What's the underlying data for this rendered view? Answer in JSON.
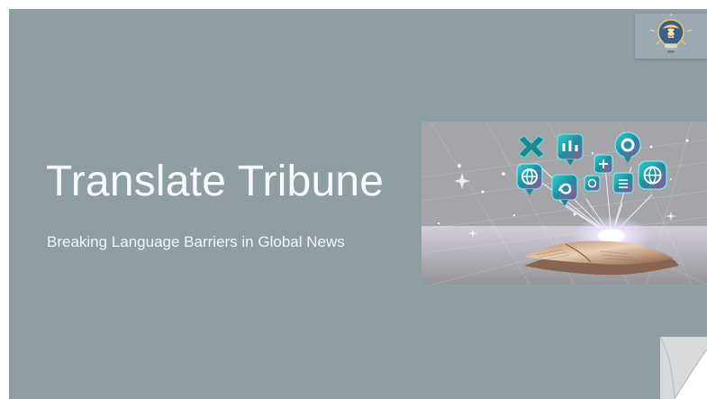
{
  "slide": {
    "title": "Translate Tribune",
    "subtitle": "Breaking Language Barriers in Global News"
  },
  "colors": {
    "slide_background": "#8e9ea3",
    "text": "#f7fbfc",
    "accent_teal": "#22bfc0",
    "accent_magenta": "#ab4b91",
    "glow": "#f8f4ff"
  },
  "icons": {
    "logo": "lightbulb-lion-logo-icon",
    "hero": "news-translation-hero-image",
    "curl": "page-curl-icon"
  }
}
